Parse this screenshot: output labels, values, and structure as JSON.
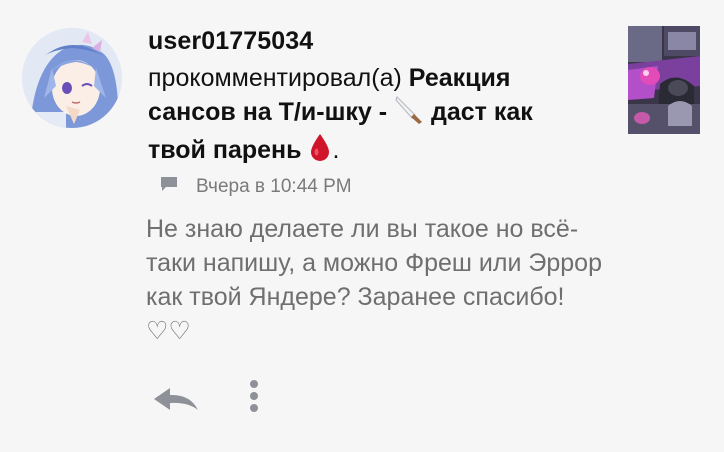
{
  "notification": {
    "username": "user01775034",
    "action": "прокомментировал(а)",
    "post_title_part1": "Реакция сансов на Т/и-шку - ",
    "post_title_part2": "даст как твой парень",
    "post_title_end": ".",
    "time": "Вчера в 10:44 PM",
    "comment": "Не знаю делаете ли вы такое но всё-таки напишу, а можно Фреш или Эррор как твой Яндере? Заранее спасибо! ♡♡"
  },
  "icons": {
    "knife": "knife-emoji-icon",
    "drop": "blood-drop-emoji-icon",
    "comment": "comment-icon",
    "reply": "reply-arrow-icon",
    "more": "more-vertical-icon"
  },
  "colors": {
    "background": "#f6f6f6",
    "title_text": "#111111",
    "meta_text": "#7a7a7a",
    "comment_text": "#6f6f6f",
    "icon_gray": "#8e9298",
    "drop_red": "#d0142a"
  }
}
